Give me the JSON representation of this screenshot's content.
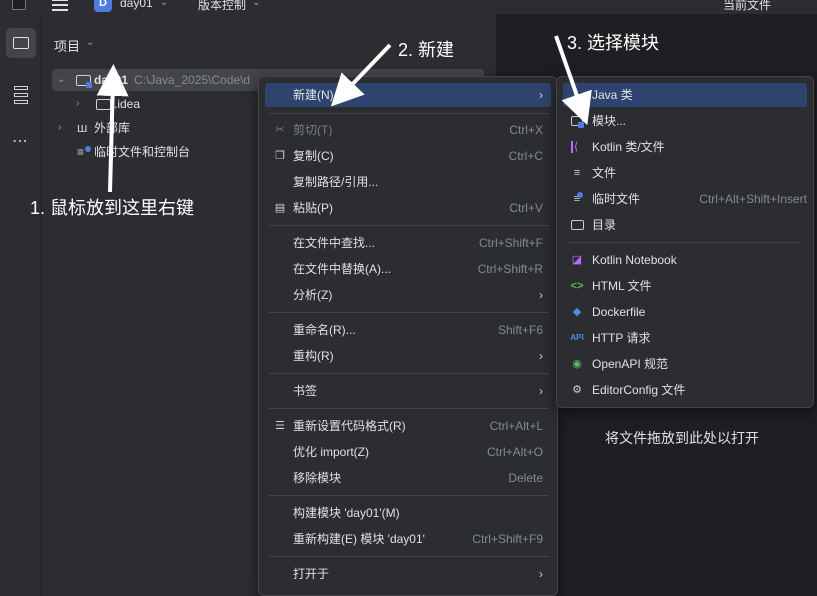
{
  "titlebar": {
    "project_badge": "D",
    "project_name": "day01",
    "vcs_label": "版本控制",
    "current_file_label": "当前文件"
  },
  "project_panel": {
    "title": "项目",
    "tree": [
      {
        "label": "day01",
        "path": "C:\\Java_2025\\Code\\d",
        "expanded": true,
        "icon": "module-folder-icon"
      },
      {
        "label": ".idea",
        "expanded": false,
        "icon": "folder-icon"
      },
      {
        "label": "外部库",
        "expanded": false,
        "icon": "library-icon"
      },
      {
        "label": "临时文件和控制台",
        "icon": "scratch-icon"
      }
    ]
  },
  "editor": {
    "drop_hint": "将文件拖放到此处以打开"
  },
  "context_menu": {
    "items": [
      {
        "label": "新建(N)",
        "submenu": true,
        "highlighted": true
      },
      {
        "label": "剪切(T)",
        "shortcut": "Ctrl+X",
        "icon": "cut-icon",
        "disabled": true
      },
      {
        "label": "复制(C)",
        "shortcut": "Ctrl+C",
        "icon": "copy-icon"
      },
      {
        "label": "复制路径/引用..."
      },
      {
        "label": "粘贴(P)",
        "shortcut": "Ctrl+V",
        "icon": "paste-icon"
      },
      {
        "label": "在文件中查找...",
        "shortcut": "Ctrl+Shift+F"
      },
      {
        "label": "在文件中替换(A)...",
        "shortcut": "Ctrl+Shift+R"
      },
      {
        "label": "分析(Z)",
        "submenu": true
      },
      {
        "label": "重命名(R)...",
        "shortcut": "Shift+F6"
      },
      {
        "label": "重构(R)",
        "submenu": true
      },
      {
        "label": "书签",
        "submenu": true
      },
      {
        "label": "重新设置代码格式(R)",
        "shortcut": "Ctrl+Alt+L",
        "icon": "reformat-icon"
      },
      {
        "label": "优化 import(Z)",
        "shortcut": "Ctrl+Alt+O"
      },
      {
        "label": "移除模块",
        "shortcut": "Delete"
      },
      {
        "label": "构建模块 'day01'(M)"
      },
      {
        "label": "重新构建(E) 模块 'day01'",
        "shortcut": "Ctrl+Shift+F9"
      },
      {
        "label": "打开于",
        "submenu": true
      }
    ]
  },
  "new_submenu": {
    "items": [
      {
        "label": "Java 类",
        "icon": "java-class-icon",
        "highlighted": true
      },
      {
        "label": "模块...",
        "icon": "module-icon"
      },
      {
        "label": "Kotlin 类/文件",
        "icon": "kotlin-icon"
      },
      {
        "label": "文件",
        "icon": "file-icon"
      },
      {
        "label": "临时文件",
        "shortcut": "Ctrl+Alt+Shift+Insert",
        "icon": "scratch-file-icon"
      },
      {
        "label": "目录",
        "icon": "directory-icon"
      },
      {
        "label": "Kotlin Notebook",
        "icon": "notebook-icon"
      },
      {
        "label": "HTML 文件",
        "icon": "html-icon"
      },
      {
        "label": "Dockerfile",
        "icon": "docker-icon"
      },
      {
        "label": "HTTP 请求",
        "icon": "api-icon",
        "icon_text": "API"
      },
      {
        "label": "OpenAPI 规范",
        "icon": "openapi-icon"
      },
      {
        "label": "EditorConfig 文件",
        "icon": "gear-icon"
      }
    ]
  },
  "annotations": {
    "step1": "1. 鼠标放到这里右键",
    "step2": "2. 新建",
    "step3": "3. 选择模块"
  },
  "colors": {
    "background": "#2b2d30",
    "editor_background": "#1e1f22",
    "highlight": "#2e436e",
    "accent": "#4e7ce2",
    "kotlin": "#b86bff",
    "html": "#5fb865",
    "docker": "#4a90e2"
  }
}
